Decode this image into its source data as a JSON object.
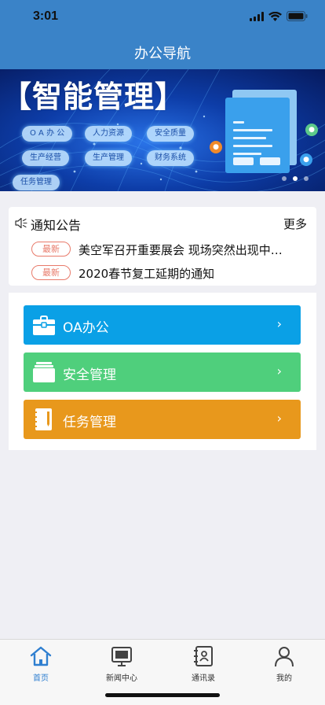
{
  "status": {
    "time": "3:01"
  },
  "nav": {
    "title": "办公导航"
  },
  "banner": {
    "title": "【智能管理】",
    "pills": [
      "O A 办 公",
      "人力资源",
      "安全质量",
      "生产经营",
      "生产管理",
      "财务系统",
      "任务管理"
    ],
    "pager_count": 3,
    "pager_active": 1
  },
  "notice": {
    "title": "通知公告",
    "more": "更多",
    "items": [
      {
        "badge": "最新",
        "text": "美空军召开重要展会 现场突然出现中…"
      },
      {
        "badge": "最新",
        "text": "2020春节复工延期的通知"
      }
    ]
  },
  "menu": {
    "items": [
      {
        "label": "OA办公",
        "color": "#0aa0e6",
        "icon": "briefcase-icon"
      },
      {
        "label": "安全管理",
        "color": "#4fcf7c",
        "icon": "folder-stack-icon"
      },
      {
        "label": "任务管理",
        "color": "#e8981c",
        "icon": "notebook-icon"
      }
    ],
    "arrow": "›"
  },
  "tabbar": {
    "tabs": [
      {
        "label": "首页",
        "icon": "home-icon",
        "active": true
      },
      {
        "label": "新闻中心",
        "icon": "monitor-icon",
        "active": false
      },
      {
        "label": "通讯录",
        "icon": "contacts-icon",
        "active": false
      },
      {
        "label": "我的",
        "icon": "user-icon",
        "active": false
      }
    ],
    "active_color": "#2f7fd0"
  }
}
